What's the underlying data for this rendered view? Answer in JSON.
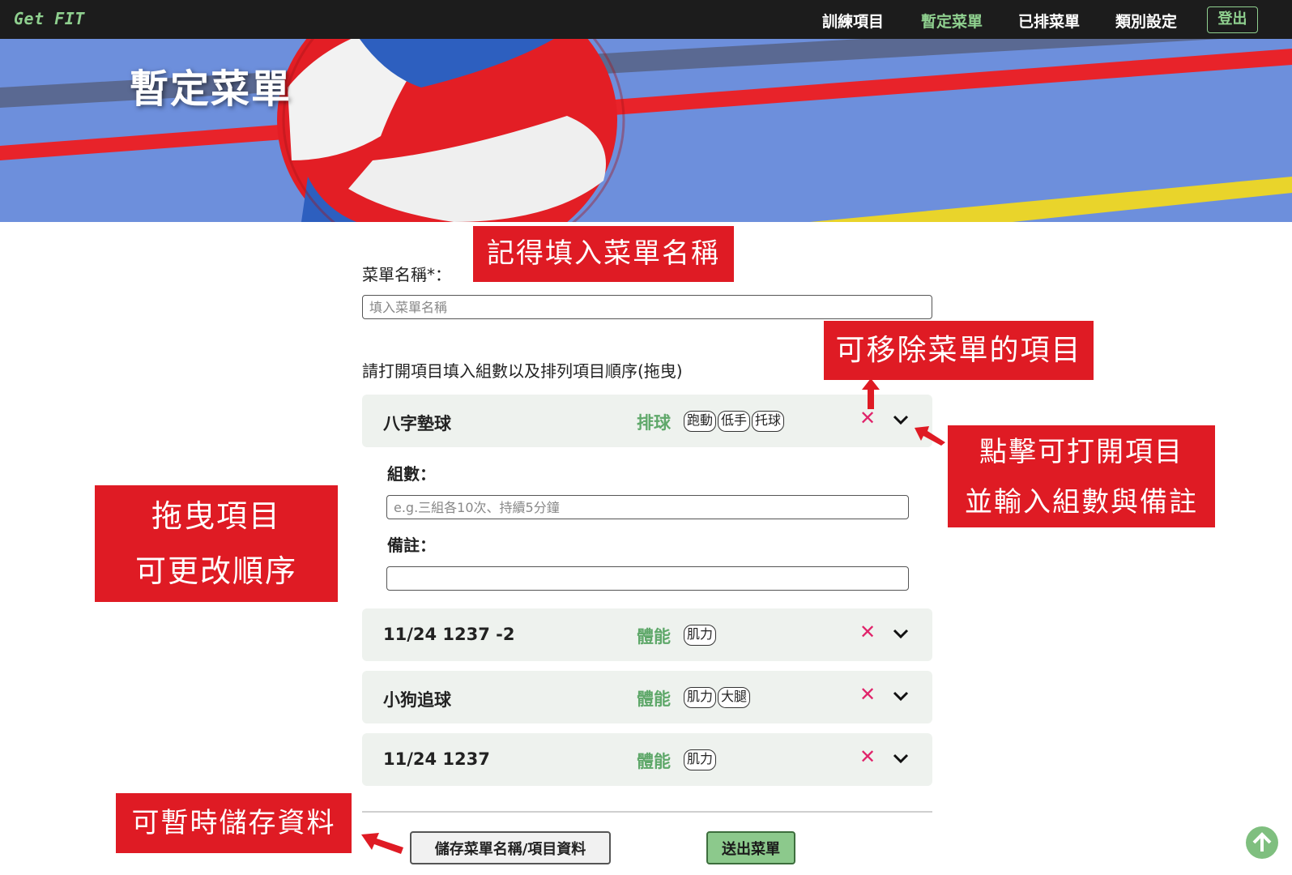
{
  "nav": {
    "brand": "Get FIT",
    "links": [
      "訓練項目",
      "暫定菜單",
      "已排菜單",
      "類別設定"
    ],
    "active_index": 1,
    "logout": "登出"
  },
  "hero": {
    "title": "暫定菜單"
  },
  "form": {
    "menu_name_label": "菜單名稱*：",
    "menu_name_placeholder": "填入菜單名稱",
    "instruction": "請打開項目填入組數以及排列項目順序(拖曳)",
    "sets_label": "組數：",
    "sets_placeholder": "e.g.三組各10次、持續5分鐘",
    "notes_label": "備註："
  },
  "items": [
    {
      "name": "八字墊球",
      "category": "排球",
      "tags": [
        "跑動",
        "低手",
        "托球"
      ],
      "expanded": true
    },
    {
      "name": "11/24 1237 -2",
      "category": "體能",
      "tags": [
        "肌力"
      ],
      "expanded": false
    },
    {
      "name": "小狗追球",
      "category": "體能",
      "tags": [
        "肌力",
        "大腿"
      ],
      "expanded": false
    },
    {
      "name": "11/24 1237",
      "category": "體能",
      "tags": [
        "肌力"
      ],
      "expanded": false
    }
  ],
  "icons": {
    "remove": "close-icon",
    "expand": "chevron-down-icon",
    "top": "arrow-up-circle-icon"
  },
  "buttons": {
    "save": "儲存菜單名稱/項目資料",
    "submit": "送出菜單"
  },
  "annotations": {
    "fill_name": "記得填入菜單名稱",
    "remove_item": "可移除菜單的項目",
    "open_item": [
      "點擊可打開項目",
      "並輸入組數與備註"
    ],
    "drag_item": [
      "拖曳項目",
      "可更改順序"
    ],
    "save_temp": "可暫時儲存資料"
  },
  "colors": {
    "accent_green": "#8fd08f",
    "category_green": "#5fa86a",
    "remove_red": "#e0246a",
    "callout_red": "#df1b24",
    "navbar": "#1c1c1c"
  }
}
